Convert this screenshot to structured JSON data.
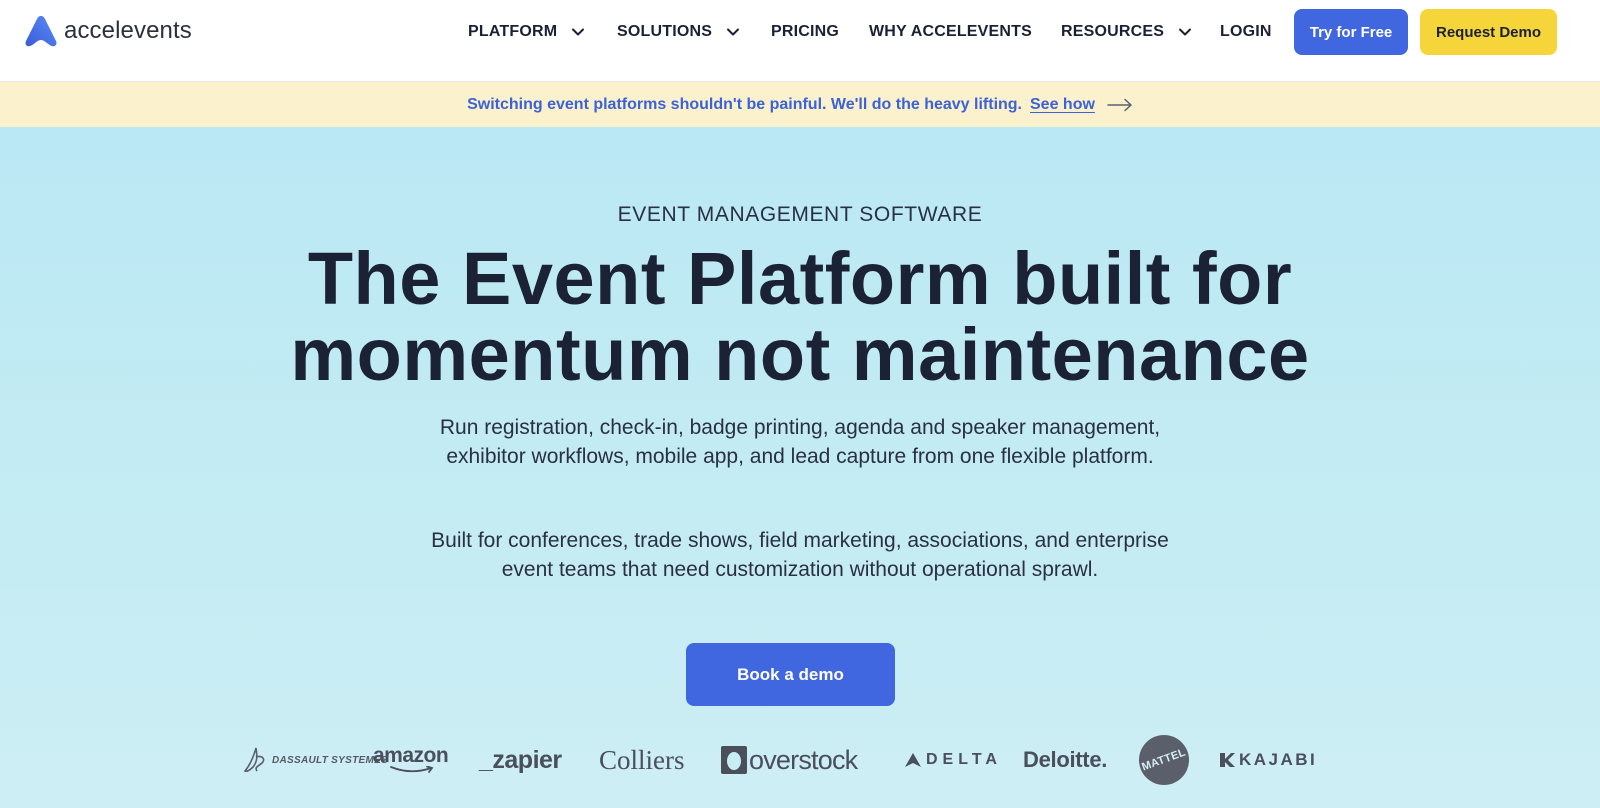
{
  "header": {
    "logo_text": "accelevents",
    "nav": [
      {
        "label": "PLATFORM",
        "has_dropdown": true
      },
      {
        "label": "SOLUTIONS",
        "has_dropdown": true
      },
      {
        "label": "PRICING",
        "has_dropdown": false
      },
      {
        "label": "WHY ACCELEVENTS",
        "has_dropdown": false
      },
      {
        "label": "RESOURCES",
        "has_dropdown": true
      },
      {
        "label": "LOGIN",
        "has_dropdown": false
      }
    ],
    "try_label": "Try for Free",
    "demo_label": "Request Demo"
  },
  "banner": {
    "text": "Switching event platforms shouldn't be painful. We'll do the heavy lifting.",
    "link_label": "See how"
  },
  "hero": {
    "eyebrow": "EVENT MANAGEMENT SOFTWARE",
    "headline_line1": "The Event Platform built for",
    "headline_line2": "momentum not maintenance",
    "paragraph1": "Run registration, check-in, badge printing, agenda and speaker management, exhibitor workflows, mobile app, and lead capture from one flexible platform.",
    "paragraph2": "Built for conferences, trade shows, field marketing, associations, and enterprise event teams that need customization without operational sprawl.",
    "cta_label": "Book a demo"
  },
  "logos": {
    "dassault": "DASSAULT SYSTEMES",
    "amazon": "amazon",
    "zapier": "_zapier",
    "colliers": "Colliers",
    "overstock": "overstock",
    "delta": "DELTA",
    "deloitte": "Deloitte.",
    "mattel": "MATTEL",
    "kajabi": "KAJABI"
  },
  "colors": {
    "primary_blue": "#4066e0",
    "demo_yellow": "#f5d53a",
    "banner_bg": "#fcf1cd",
    "hero_bg": "#bae8f4",
    "heading": "#1c2236"
  }
}
